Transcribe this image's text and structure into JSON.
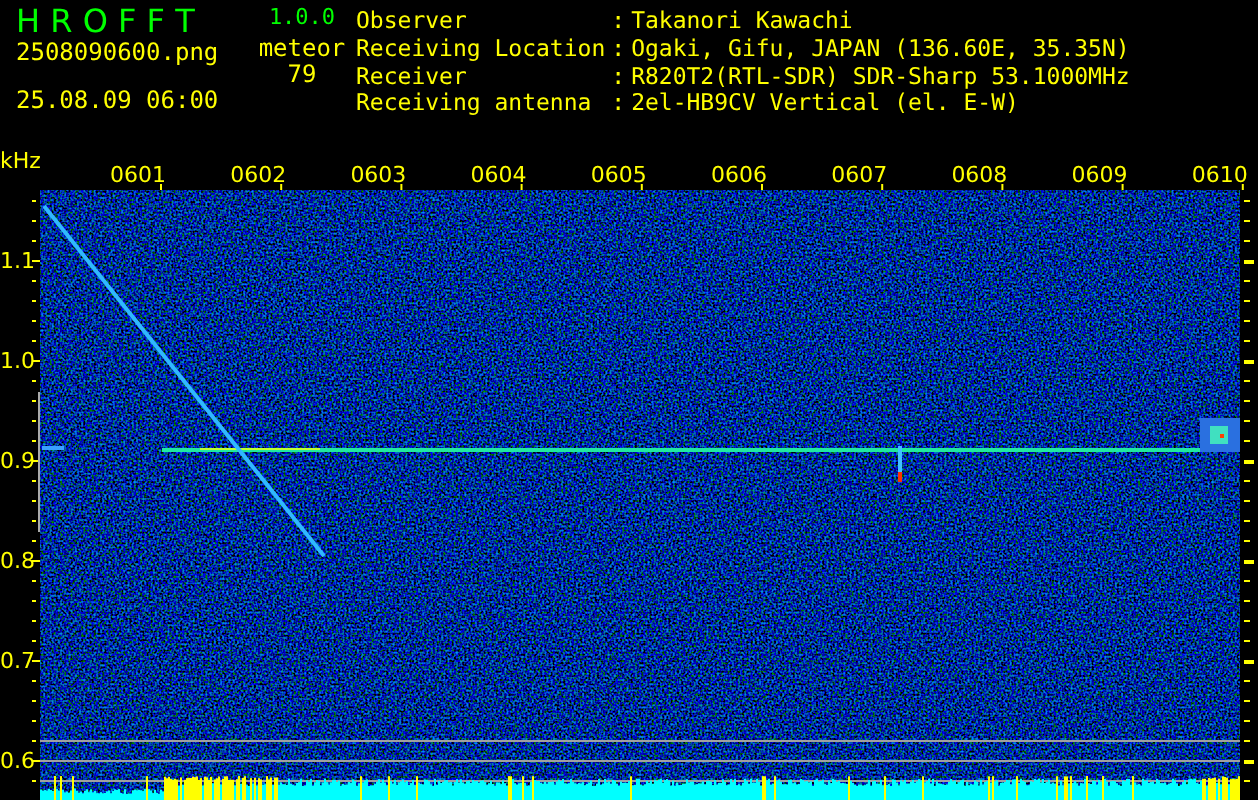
{
  "app": {
    "name": "H R O F F T",
    "version": "1.0.0"
  },
  "file": "2508090600.png",
  "timestamp": "25.08.09 06:00",
  "meteor": {
    "label": "meteor",
    "count": "79"
  },
  "info": [
    {
      "label": "Observer",
      "separator": ":",
      "value": "Takanori Kawachi"
    },
    {
      "label": "Receiving Location",
      "separator": ":",
      "value": "Ogaki, Gifu, JAPAN (136.60E, 35.35N)"
    },
    {
      "label": "Receiver",
      "separator": ":",
      "value": "R820T2(RTL-SDR) SDR-Sharp 53.1000MHz"
    },
    {
      "label": "Receiving antenna",
      "separator": ":",
      "value": "2el-HB9CV Vertical (el. E-W)"
    }
  ],
  "spectrogram": {
    "unit": "kHz",
    "time_labels": [
      "0601",
      "0602",
      "0603",
      "0604",
      "0605",
      "0606",
      "0607",
      "0608",
      "0609",
      "0610"
    ],
    "frequency_labels": [
      "1.1",
      "1.0",
      "0.9",
      "0.8",
      "0.7",
      "0.6"
    ]
  }
}
